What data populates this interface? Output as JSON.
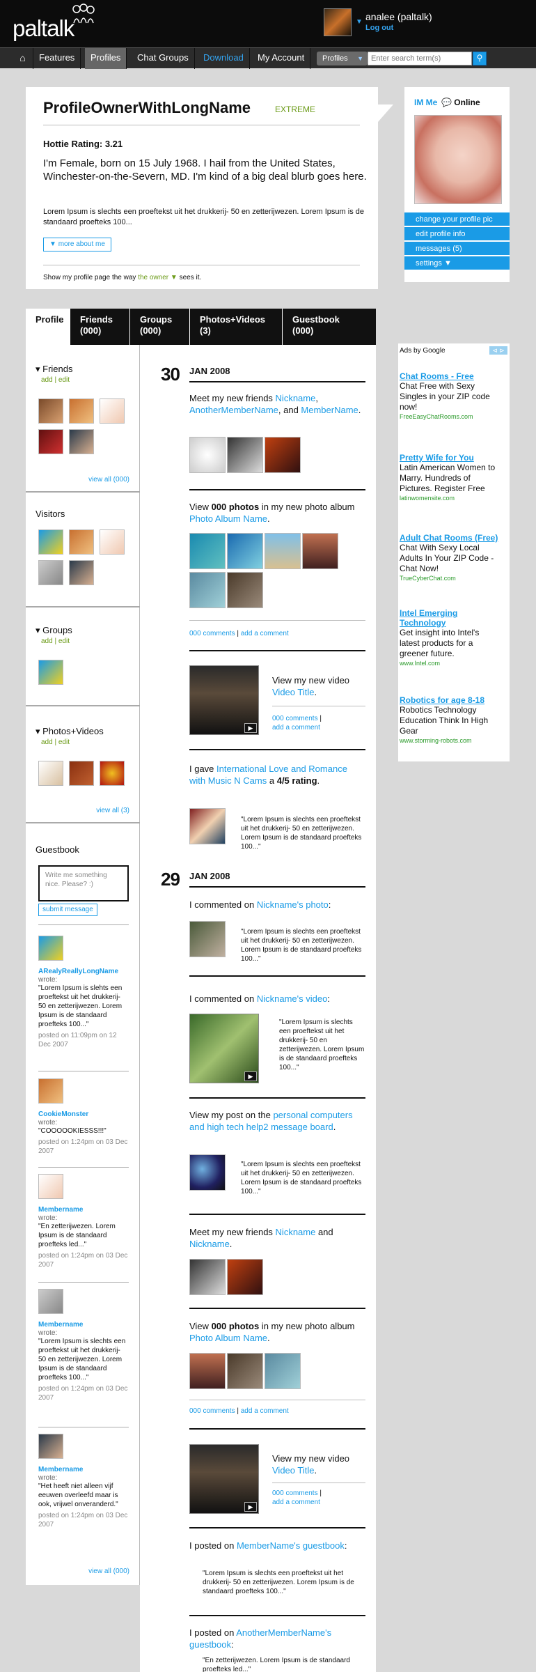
{
  "header": {
    "logo": "paltalk",
    "user_name": "analee (paltalk)",
    "logout": "Log out"
  },
  "nav": {
    "items": [
      "Features",
      "Profiles",
      "Chat Groups",
      "Download",
      "My Account"
    ],
    "search_select": "Profiles",
    "search_placeholder": "Enter search term(s)"
  },
  "profile": {
    "name": "ProfileOwnerWithLongName",
    "tier": "EXTREME",
    "hottie": "Hottie Rating: 3.21",
    "bio": "I'm Female, born on 15 July 1968. I hail from the United States, Winchester-on-the-Severn, MD. I'm kind of a big deal blurb goes here.",
    "lorem": "Lorem Ipsum is slechts een proeftekst uit het drukkerij- 50 en zetterijwezen. Lorem Ipsum is de standaard proefteks 100...",
    "more_about": "more about me",
    "show_prefix": "Show my profile page the way",
    "show_value": "the owner",
    "show_suffix": "sees it."
  },
  "sidebar_right": {
    "im_me": "IM Me",
    "online": "Online",
    "menu": [
      "change your profile pic",
      "edit profile info",
      "messages (5)",
      "settings"
    ]
  },
  "tabs": [
    {
      "label": "Profile",
      "count": ""
    },
    {
      "label": "Friends",
      "count": "(000)"
    },
    {
      "label": "Groups",
      "count": "(000)"
    },
    {
      "label": "Photos+Videos",
      "count": "(3)"
    },
    {
      "label": "Guestbook",
      "count": "(000)"
    }
  ],
  "left": {
    "friends": {
      "title": "Friends",
      "add": "add",
      "edit": "edit",
      "view_all": "view all (000)"
    },
    "visitors": {
      "title": "Visitors"
    },
    "groups": {
      "title": "Groups",
      "add": "add",
      "edit": "edit"
    },
    "photos": {
      "title": "Photos+Videos",
      "add": "add",
      "edit": "edit",
      "view_all": "view all (3)"
    },
    "guestbook": {
      "title": "Guestbook",
      "placeholder": "Write me something nice. Please? :)",
      "submit": "submit message",
      "wrote": "wrote:",
      "view_all": "view all (000)",
      "entries": [
        {
          "name": "ARealyReallyLongName",
          "text": "\"Lorem Ipsum is slehts een proeftekst uit het drukkerij- 50 en zetterijwezen. Lorem Ipsum is de standaard proefteks 100...\"",
          "time": "posted on 11:09pm on 12 Dec 2007"
        },
        {
          "name": "CookieMonster",
          "text": "\"COOOOOKIESSS!!!\"",
          "time": "posted on 1:24pm on 03 Dec 2007"
        },
        {
          "name": "Membername",
          "text": "\"En zetterijwezen. Lorem Ipsum is de standaard proefteks led...\"",
          "time": "posted on 1:24pm on 03 Dec 2007"
        },
        {
          "name": "Membername",
          "text": "\"Lorem Ipsum is slechts een proeftekst uit het drukkerij- 50 en zetterijwezen. Lorem Ipsum is de standaard proefteks 100...\"",
          "time": "posted on 1:24pm on 03 Dec 2007"
        },
        {
          "name": "Membername",
          "text": "\"Het heeft niet alleen vijf eeuwen overleefd maar is ook, vrijwel onveranderd.\"",
          "time": "posted on 1:24pm on 03 Dec 2007"
        }
      ]
    }
  },
  "feed": {
    "day1": {
      "num": "30",
      "month": "JAN 2008"
    },
    "day2": {
      "num": "29",
      "month": "JAN 2008"
    },
    "comments": "000 comments",
    "add_comment": "add a comment",
    "quote": "\"Lorem Ipsum is slechts een proeftekst uit het drukkerij- 50 en zetterijwezen. Lorem Ipsum is de standaard proefteks 100...\"",
    "i1": {
      "pre": "Meet my new friends ",
      "a": "Nickname",
      "mid": ", ",
      "b": "AnotherMemberName",
      "and": ", and ",
      "c": "MemberName",
      "end": "."
    },
    "i2": {
      "pre": "View ",
      "bold": "000 photos",
      "mid": " in my new photo album ",
      "link": "Photo Album Name",
      "end": "."
    },
    "i3": {
      "pre": "View my new video ",
      "link": "Video Title",
      "end": "."
    },
    "i4": {
      "pre": "I gave ",
      "link": "International Love and Romance with Music N Cams",
      "mid": " a ",
      "bold": "4/5 rating",
      "end": "."
    },
    "i5": {
      "pre": "I commented on ",
      "link": "Nickname's photo",
      "end": ":"
    },
    "i6": {
      "pre": "I commented on ",
      "link": "Nickname's video",
      "end": ":"
    },
    "i7": {
      "pre": "View my post on the ",
      "link": "personal computers and high tech help2 message board",
      "end": "."
    },
    "i8": {
      "pre": "Meet my new friends ",
      "a": "Nickname",
      "and": " and ",
      "b": "Nickname",
      "end": "."
    },
    "i9": {
      "pre": "I posted on ",
      "link": "MemberName's guestbook",
      "end": ":"
    },
    "i10": {
      "pre": "I posted on ",
      "link": "AnotherMemberName's guestbook",
      "end": ":",
      "quote": "\"En zetterijwezen. Lorem Ipsum is de standaard proefteks led...\""
    }
  },
  "ads": {
    "label": "Ads by Google",
    "items": [
      {
        "title": "Chat Rooms - Free",
        "body": "Chat Free with Sexy Singles in your ZIP code now!",
        "url": "FreeEasyChatRooms.com"
      },
      {
        "title": "Pretty Wife for You",
        "body": "Latin American Women to Marry. Hundreds of Pictures. Register Free",
        "url": "latinwomensite.com"
      },
      {
        "title": "Adult Chat Rooms (Free)",
        "body": "Chat With Sexy Local Adults In Your ZIP Code - Chat Now!",
        "url": "TrueCyberChat.com"
      },
      {
        "title": "Intel Emerging Technology",
        "body": "Get insight into Intel's latest products for a greener future.",
        "url": "www.Intel.com"
      },
      {
        "title": "Robotics for age 8-18",
        "body": "Robotics Technology Education Think In High Gear",
        "url": "www.storming-robots.com"
      }
    ]
  }
}
